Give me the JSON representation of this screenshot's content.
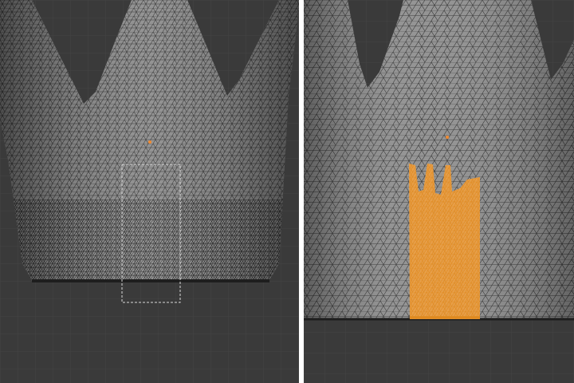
{
  "viewports": [
    {
      "id": "before",
      "mode": "wireframe-box-select",
      "selection": "none"
    },
    {
      "id": "after",
      "mode": "wireframe-face-selected",
      "selection": "front-strip"
    }
  ],
  "colors": {
    "viewport_background": "#3a3a3a",
    "grid_line": "#444444",
    "mesh_fill": "#8e8e8e",
    "mesh_wire": "#1e1e1e",
    "selection_fill": "#f0a040",
    "selection_wire": "#e08a20",
    "selection_box": "#d8d8d8",
    "origin_dot": "#f08a30",
    "separator": "#ffffff"
  },
  "icons": {
    "origin": "origin-dot-icon"
  }
}
